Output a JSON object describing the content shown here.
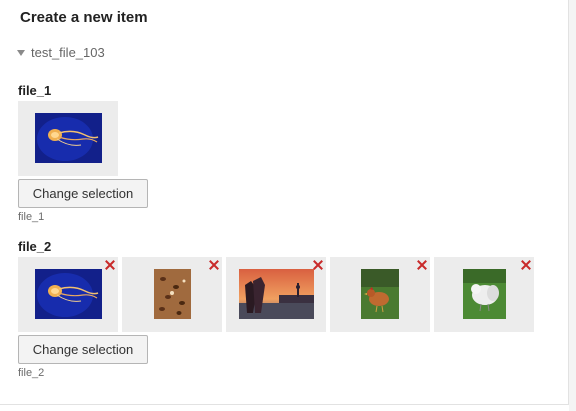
{
  "form": {
    "title": "Create a new item",
    "group": {
      "label": "test_file_103",
      "expanded": true
    }
  },
  "fields": [
    {
      "label": "file_1",
      "button_label": "Change selection",
      "hint": "file_1",
      "images": [
        {
          "subject": "jellyfish",
          "removable": false
        }
      ]
    },
    {
      "label": "file_2",
      "button_label": "Change selection",
      "hint": "file_2",
      "images": [
        {
          "subject": "jellyfish",
          "removable": true
        },
        {
          "subject": "coffee-beans",
          "removable": true
        },
        {
          "subject": "city-sunset",
          "removable": true
        },
        {
          "subject": "chicken-brown",
          "removable": true
        },
        {
          "subject": "chicken-white",
          "removable": true
        }
      ]
    }
  ],
  "colors": {
    "remove_icon": "#c92a2a",
    "thumb_background": "#ececec"
  }
}
